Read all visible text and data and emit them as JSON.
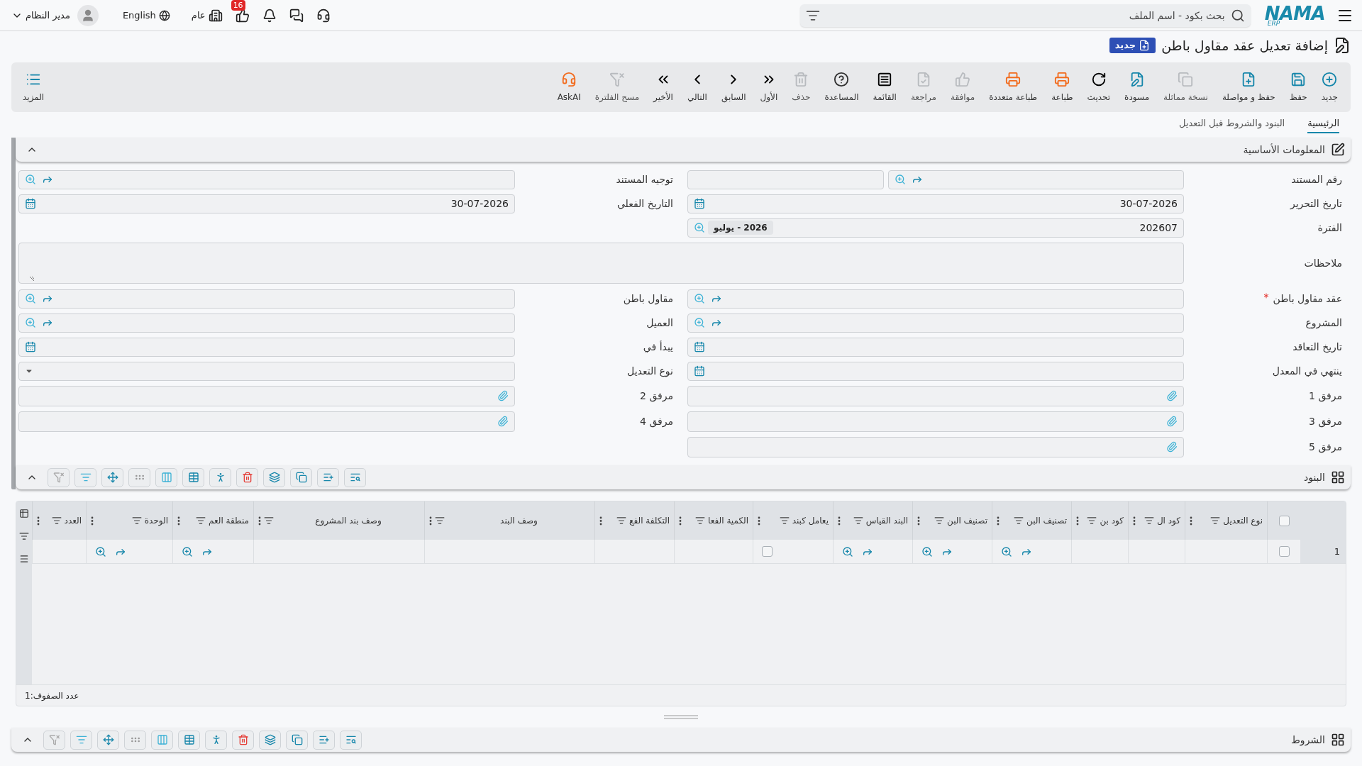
{
  "topbar": {
    "logo": {
      "text": "NAMA",
      "subtext": "ERP"
    },
    "search": {
      "placeholder": "بحث بكود - اسم الملف"
    },
    "user": "مدير النظام",
    "language": "English",
    "branch": "عام",
    "likes_badge": "16"
  },
  "page": {
    "title": "إضافة تعديل عقد مقاول باطن",
    "status": "جديد"
  },
  "toolbar": {
    "buttons": [
      {
        "label": "جديد",
        "disabled": false
      },
      {
        "label": "حفظ",
        "disabled": false
      },
      {
        "label": "حفظ و مواصلة",
        "disabled": false
      },
      {
        "label": "نسخة مماثلة",
        "disabled": true
      },
      {
        "label": "مسودة",
        "disabled": false
      },
      {
        "label": "تحديث",
        "disabled": false
      },
      {
        "label": "طباعة",
        "disabled": false
      },
      {
        "label": "طباعة متعددة",
        "disabled": false
      },
      {
        "label": "موافقة",
        "disabled": true
      },
      {
        "label": "مراجعة",
        "disabled": true
      },
      {
        "label": "القائمة",
        "disabled": false
      },
      {
        "label": "المساعدة",
        "disabled": false
      },
      {
        "label": "حذف",
        "disabled": true
      },
      {
        "label": "الأول",
        "disabled": false
      },
      {
        "label": "السابق",
        "disabled": false
      },
      {
        "label": "التالي",
        "disabled": false
      },
      {
        "label": "الأخير",
        "disabled": false
      },
      {
        "label": "مسح الفلترة",
        "disabled": true
      },
      {
        "label": "AskAI",
        "disabled": false
      }
    ],
    "more": "المزيد"
  },
  "tabs": [
    {
      "label": "الرئيسية",
      "selected": true
    },
    {
      "label": "البنود والشروط قبل التعديل",
      "selected": false
    }
  ],
  "basic_info": {
    "title": "المعلومات الأساسية",
    "expanded": true,
    "rows": [
      [
        {
          "label": "رقم المستند",
          "kind": "doc_number",
          "required": false
        },
        {
          "label": "توجيه المستند",
          "kind": "lookup",
          "required": false
        }
      ],
      [
        {
          "label": "تاريخ التحرير",
          "kind": "date",
          "value": "30-07-2026",
          "required": false
        },
        {
          "label": "التاريخ الفعلي",
          "kind": "date",
          "value": "30-07-2026",
          "required": false
        }
      ],
      [
        {
          "label": "الفترة",
          "kind": "period",
          "value": "202607",
          "chip": "2026 - يوليو",
          "required": false
        }
      ],
      [
        {
          "label": "ملاحظات",
          "kind": "textarea",
          "required": false
        }
      ],
      [
        {
          "label": "عقد مقاول باطن",
          "kind": "lookup",
          "required": true
        },
        {
          "label": "مقاول باطن",
          "kind": "lookup",
          "required": false
        }
      ],
      [
        {
          "label": "المشروع",
          "kind": "lookup",
          "required": false
        },
        {
          "label": "العميل",
          "kind": "lookup",
          "required": false
        }
      ],
      [
        {
          "label": "تاريخ التعاقد",
          "kind": "date",
          "required": false
        },
        {
          "label": "يبدأ في",
          "kind": "date",
          "required": false
        }
      ],
      [
        {
          "label": "ينتهي في المعدل",
          "kind": "date",
          "required": false
        },
        {
          "label": "نوع التعديل",
          "kind": "select",
          "required": false
        }
      ],
      [
        {
          "label": "مرفق 1",
          "kind": "attachment",
          "required": false
        },
        {
          "label": "مرفق 2",
          "kind": "attachment",
          "required": false
        }
      ],
      [
        {
          "label": "مرفق 3",
          "kind": "attachment",
          "required": false
        },
        {
          "label": "مرفق 4",
          "kind": "attachment",
          "required": false
        }
      ],
      [
        {
          "label": "مرفق 5",
          "kind": "attachment",
          "required": false
        }
      ]
    ]
  },
  "items": {
    "title": "البنود",
    "expanded": true,
    "all_selected": false,
    "columns": [
      "نوع التعديل",
      "كود ال",
      "كود بن",
      "تصنيف البن",
      "تصنيف البن",
      "البند القياس",
      "يعامل كبند",
      "الكمية الفعا",
      "التكلفة الفع",
      "وصف البند",
      "وصف بند المشروع",
      "منطقة العم",
      "الوحدة",
      "العدد"
    ],
    "rows": [
      {
        "number": "1",
        "selected": false,
        "cells": [
          {
            "kind": "empty"
          },
          {
            "kind": "empty"
          },
          {
            "kind": "empty"
          },
          {
            "kind": "lookup"
          },
          {
            "kind": "lookup"
          },
          {
            "kind": "lookup"
          },
          {
            "kind": "checkbox",
            "checked": false
          },
          {
            "kind": "empty"
          },
          {
            "kind": "empty"
          },
          {
            "kind": "empty"
          },
          {
            "kind": "empty"
          },
          {
            "kind": "lookup"
          },
          {
            "kind": "lookup"
          },
          {
            "kind": "empty"
          }
        ]
      }
    ],
    "row_count": "عدد الصفوف:1"
  },
  "terms": {
    "title": "الشروط",
    "expanded": true
  }
}
